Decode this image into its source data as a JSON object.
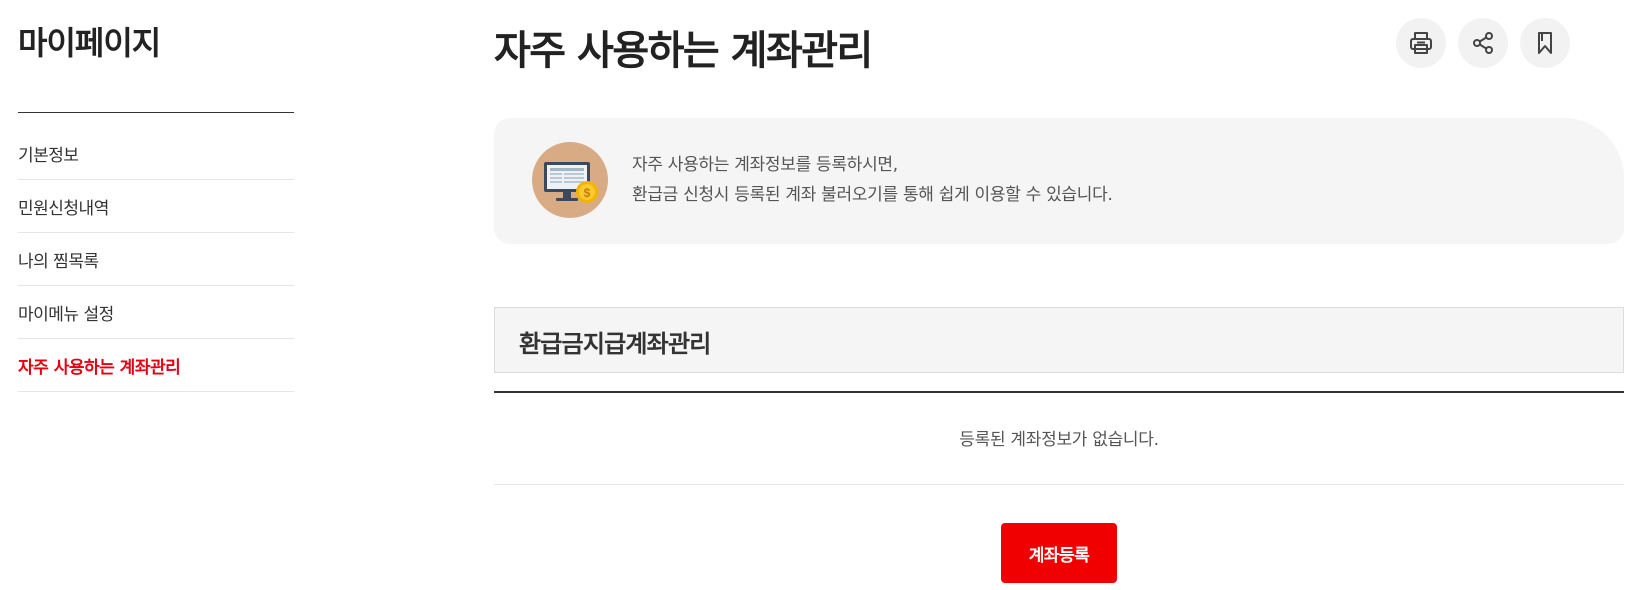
{
  "sidebar": {
    "title": "마이페이지",
    "items": [
      {
        "label": "기본정보"
      },
      {
        "label": "민원신청내역"
      },
      {
        "label": "나의 찜목록"
      },
      {
        "label": "마이메뉴 설정"
      },
      {
        "label": "자주 사용하는 계좌관리",
        "active": true
      }
    ]
  },
  "header": {
    "title": "자주 사용하는 계좌관리",
    "tools": [
      "print-icon",
      "share-icon",
      "bookmark-icon"
    ]
  },
  "info": {
    "icon": "monitor-coin-icon",
    "line1": "자주 사용하는 계좌정보를 등록하시면,",
    "line2": "환급금 신청시 등록된 계좌 불러오기를 통해 쉽게 이용할 수 있습니다."
  },
  "section": {
    "title": "환급금지급계좌관리",
    "empty_message": "등록된 계좌정보가 없습니다."
  },
  "actions": {
    "register_label": "계좌등록"
  },
  "colors": {
    "accent": "#e60012",
    "button": "#f00000",
    "panel": "#f5f5f5"
  }
}
